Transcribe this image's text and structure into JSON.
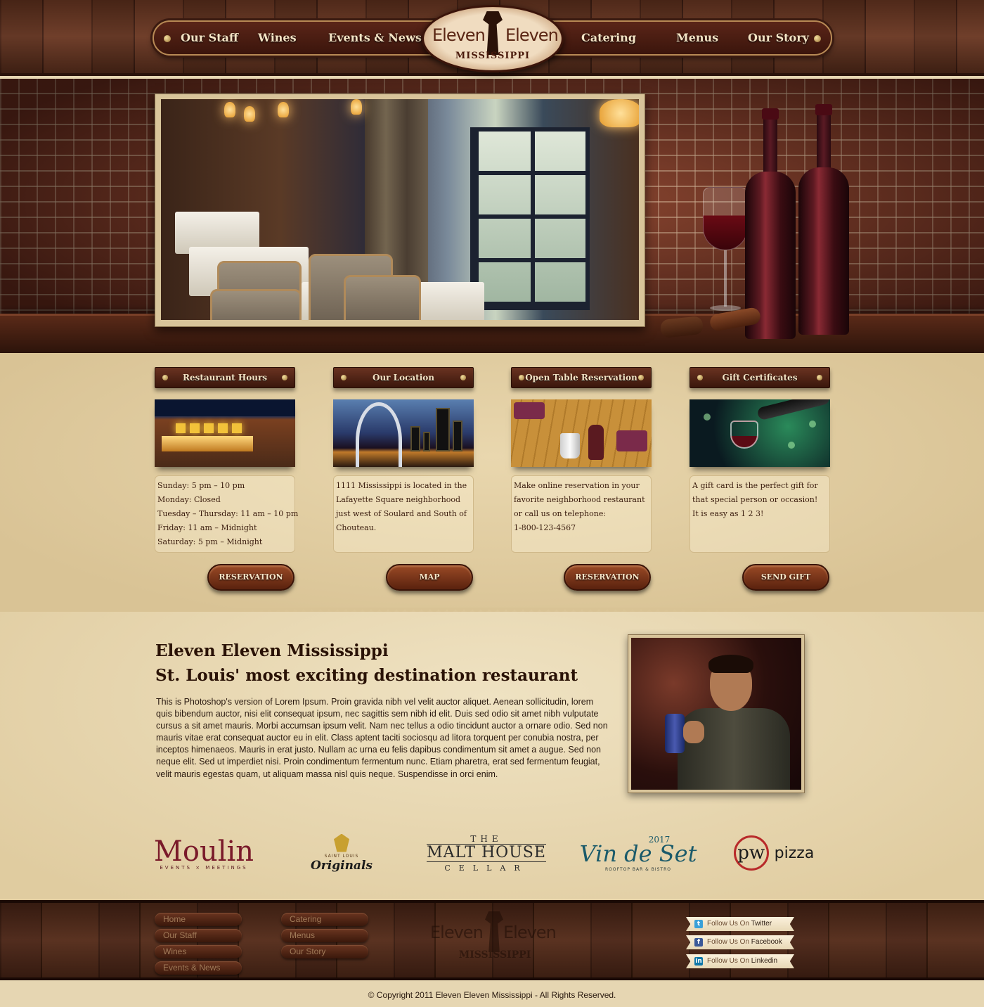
{
  "nav": {
    "items": [
      {
        "label": "Our Staff"
      },
      {
        "label": "Wines"
      },
      {
        "label": "Events & News"
      },
      {
        "label": "Catering"
      },
      {
        "label": "Menus"
      },
      {
        "label": "Our Story"
      }
    ]
  },
  "logo": {
    "left_word": "Eleven",
    "right_word": "Eleven",
    "sub": "MISSISSIPPI"
  },
  "cards": [
    {
      "title": "Restaurant Hours",
      "lines": [
        "Sunday: 5 pm – 10 pm",
        "Monday: Closed",
        "Tuesday – Thursday: 11 am – 10 pm",
        "Friday: 11 am – Midnight",
        "Saturday: 5 pm – Midnight"
      ],
      "button": "RESERVATION"
    },
    {
      "title": "Our Location",
      "lines": [
        "1111 Mississippi is located in the",
        "Lafayette Square neighborhood",
        "just west of Soulard and South of",
        "Chouteau."
      ],
      "button": "MAP"
    },
    {
      "title": "Open Table Reservation",
      "lines": [
        "Make online reservation in your",
        "favorite neighborhood restaurant",
        "or call us on telephone:",
        "1-800-123-4567"
      ],
      "button": "RESERVATION"
    },
    {
      "title": "Gift Certificates",
      "lines": [
        "A gift card is the perfect gift for",
        "that special person or occasion!",
        "It is easy as 1 2 3!"
      ],
      "button": "SEND GIFT"
    }
  ],
  "about": {
    "title_line1": "Eleven Eleven Mississippi",
    "title_line2": "St. Louis' most exciting destination restaurant",
    "body": "This is Photoshop's version  of Lorem Ipsum. Proin gravida nibh vel velit auctor aliquet. Aenean sollicitudin, lorem quis bibendum auctor, nisi elit consequat ipsum, nec sagittis sem nibh id elit. Duis sed odio sit amet nibh vulputate cursus a sit amet mauris. Morbi accumsan ipsum velit. Nam nec tellus a odio tincidunt auctor a ornare odio. Sed non  mauris vitae erat consequat auctor eu in elit. Class aptent taciti sociosqu ad litora torquent per conubia nostra, per inceptos himenaeos. Mauris in erat justo. Nullam ac urna eu felis dapibus condimentum sit amet a augue. Sed non neque elit. Sed ut imperdiet nisi. Proin condimentum fermentum nunc. Etiam pharetra, erat sed fermentum feugiat, velit mauris egestas quam, ut aliquam massa nisl quis neque. Suspendisse in orci enim."
  },
  "partners": {
    "moulin": {
      "name": "Moulin",
      "tag": "EVENTS × MEETINGS"
    },
    "originals": {
      "tiny": "SAINT LOUIS",
      "name": "Originals"
    },
    "malthouse": {
      "top": "THE",
      "mid": "MALT HOUSE",
      "bot": "CELLAR"
    },
    "vin": {
      "year": "2017",
      "name": "Vin de Set",
      "tag": "ROOFTOP BAR & BISTRO"
    },
    "pw": {
      "mark": "pw",
      "name": "pizza"
    }
  },
  "footer": {
    "col1": [
      "Home",
      "Our Staff",
      "Wines",
      "Events & News"
    ],
    "col2": [
      "Catering",
      "Menus",
      "Our Story"
    ],
    "social": [
      {
        "prefix": "Follow Us On ",
        "network": "Twitter",
        "icon": "twitter-icon",
        "color": "#3aa0d8"
      },
      {
        "prefix": "Follow Us On ",
        "network": "Facebook",
        "icon": "facebook-icon",
        "color": "#3b5998"
      },
      {
        "prefix": "Follow Us On ",
        "network": "Linkedin",
        "icon": "linkedin-icon",
        "color": "#0e76a8"
      }
    ],
    "copyright": "© Copyright 2011 Eleven Eleven Mississippi - All Rights Reserved."
  },
  "colors": {
    "wood_dark": "#3a170c",
    "parchment": "#e6d6b2",
    "cream_text": "#f4e3c4",
    "brass": "#c8a050"
  }
}
